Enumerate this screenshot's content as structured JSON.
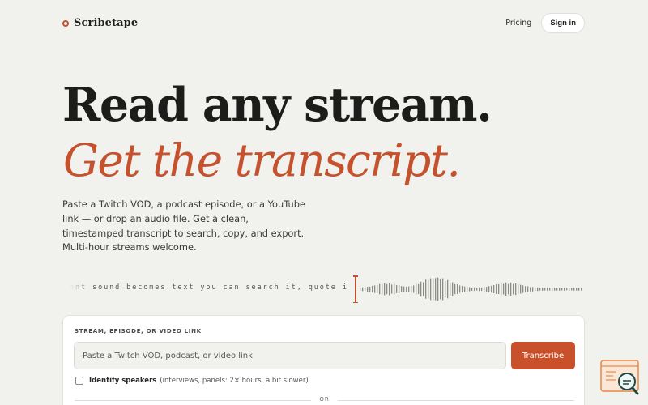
{
  "brand": {
    "name": "Scribetape",
    "accent": "#c8502a"
  },
  "nav": {
    "pricing": "Pricing",
    "sign_in": "Sign in"
  },
  "hero": {
    "line1": "Read any stream.",
    "line2": "Get the transcript.",
    "lede": "Paste a Twitch VOD, a podcast episode, or a YouTube link — or drop an audio file. Get a clean, timestamped transcript to search, copy, and export. Multi-hour streams welcome."
  },
  "strip": {
    "ticker_text": "ent sound becomes text you can search it, quote it"
  },
  "card": {
    "label": "STREAM, EPISODE, OR VIDEO LINK",
    "input_placeholder": "Paste a Twitch VOD, podcast, or video link",
    "input_value": "",
    "transcribe_label": "Transcribe",
    "speakers_label": "Identify speakers",
    "speakers_note": "(interviews, panels: 2× hours, a bit slower)",
    "speakers_checked": false,
    "divider_text": "OR"
  },
  "widget": {
    "icon": "search-chat-icon"
  }
}
